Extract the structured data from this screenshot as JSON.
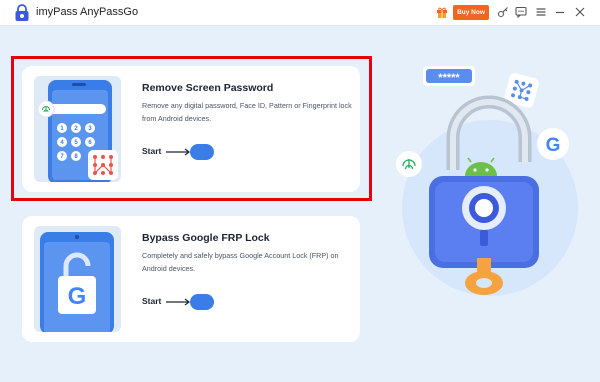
{
  "app": {
    "title": "imyPass AnyPassGo",
    "buy_now_label": "Buy Now"
  },
  "toolbar": {
    "icons": [
      "gift-icon",
      "key-icon",
      "chat-icon",
      "menu-icon",
      "minimize-icon",
      "close-icon"
    ]
  },
  "options": [
    {
      "title": "Remove Screen Password",
      "description": "Remove any digital password, Face ID, Pattern or Fingerprint lock from Android devices.",
      "start_label": "Start"
    },
    {
      "title": "Bypass Google FRP Lock",
      "description": "Completely and safely bypass Google Account Lock (FRP) on Android devices.",
      "start_label": "Start"
    }
  ],
  "hero": {
    "password_stars": "*****"
  },
  "colors": {
    "accent_blue": "#3b7de6",
    "buy_orange": "#f26522",
    "highlight_red": "#e60012",
    "background": "#e6f0fb"
  }
}
